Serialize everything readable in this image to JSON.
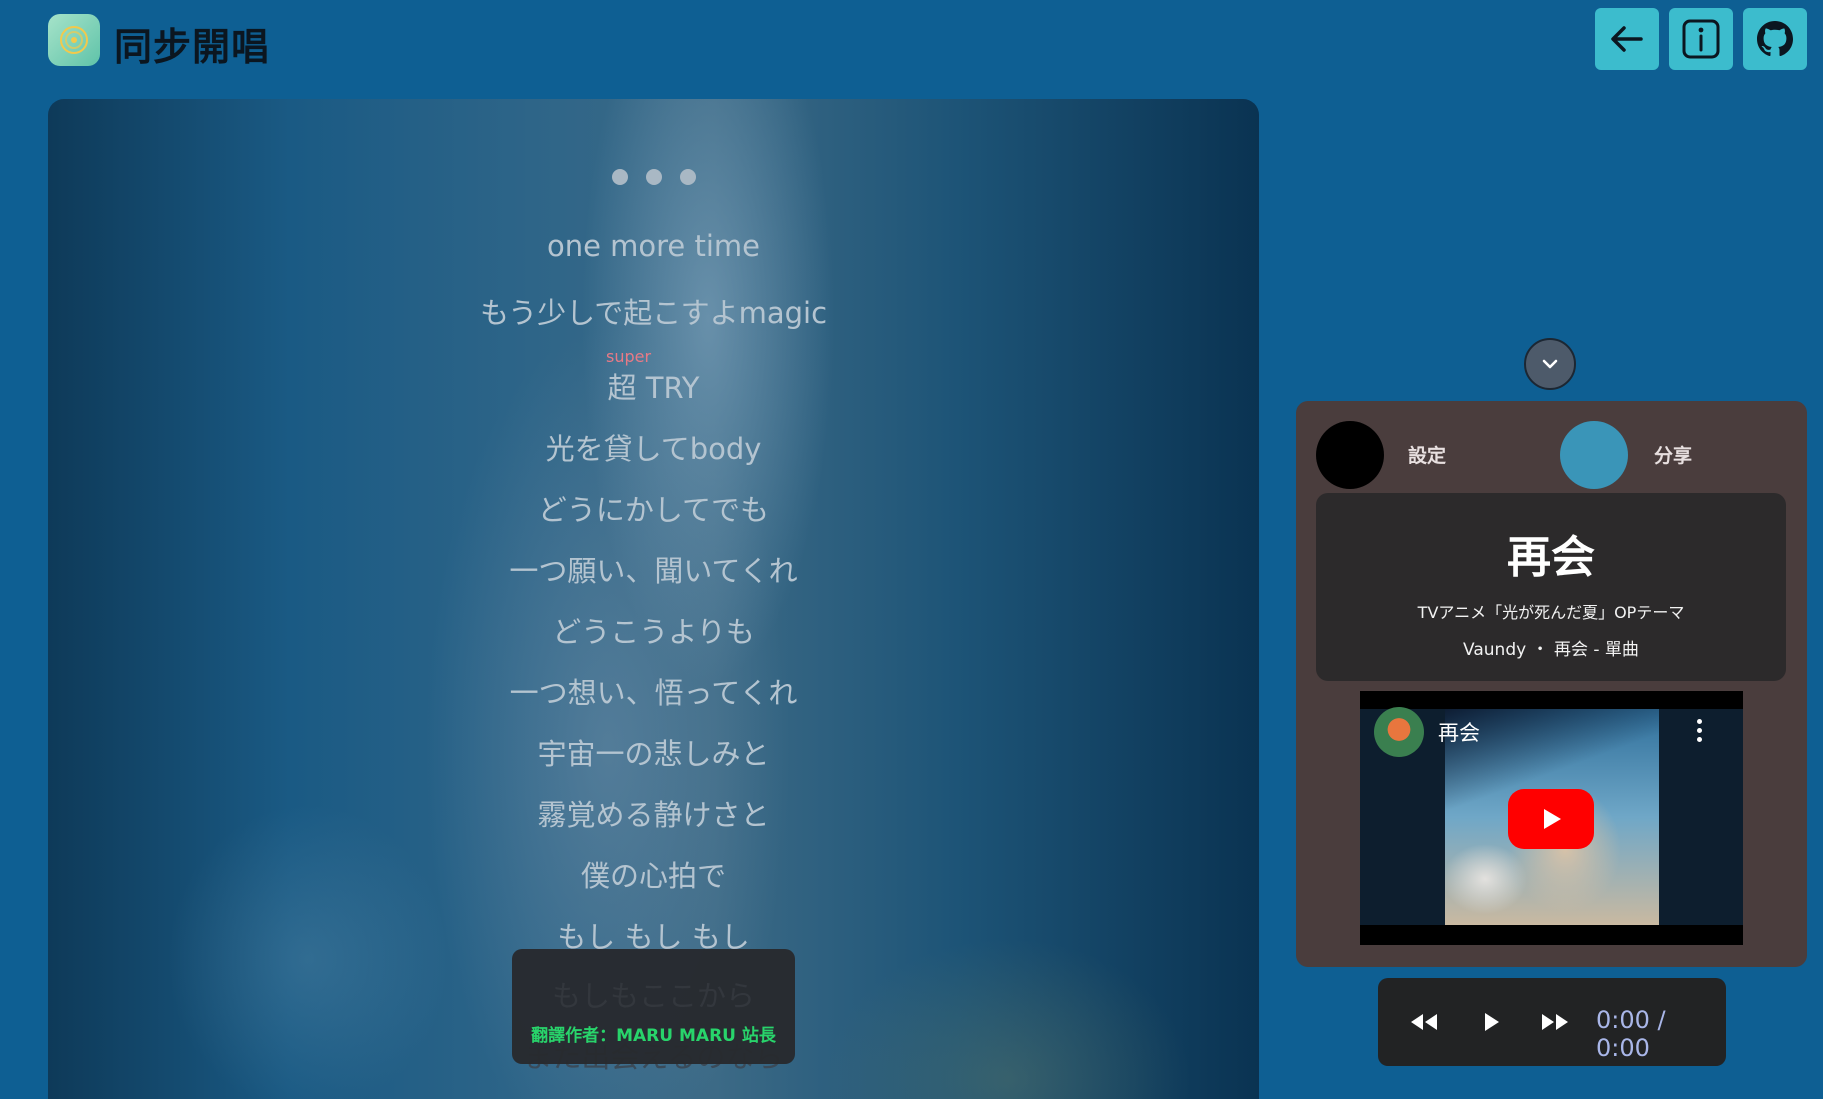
{
  "app": {
    "title": "同步開唱"
  },
  "header": {
    "icons": [
      "app-logo-icon",
      "back-arrow-icon",
      "info-icon",
      "github-icon"
    ]
  },
  "lyrics": {
    "lines": [
      "one more time",
      "もう少しで起こすよmagic",
      "超 TRY",
      "光を貸してbody",
      "どうにかしてでも",
      "一つ願い、聞いてくれ",
      "どうこうよりも",
      "一つ想い、悟ってくれ",
      "宇宙一の悲しみと",
      "霧覚める静けさと",
      "僕の心拍で",
      "もし もし もし",
      "もしもここから",
      "また出会えるのなら"
    ],
    "ruby": "super"
  },
  "credit": {
    "text": "翻譯作者：MARU MARU 站長"
  },
  "side": {
    "settings_label": "設定",
    "share_label": "分享",
    "song_title": "再会",
    "song_subtitle": "TVアニメ「光が死んだ夏」OPテーマ",
    "song_meta": "Vaundy ・ 再会 - 單曲",
    "video_title": "再会"
  },
  "player": {
    "time": "0:00 / 0:00"
  },
  "colors": {
    "background": "#0e5f93",
    "accent_button": "#3cbccd",
    "card": "#4a3d3d",
    "credit_green": "#28d46b",
    "ruby_pink": "#e87a86",
    "share_circle": "#3a95b8"
  }
}
